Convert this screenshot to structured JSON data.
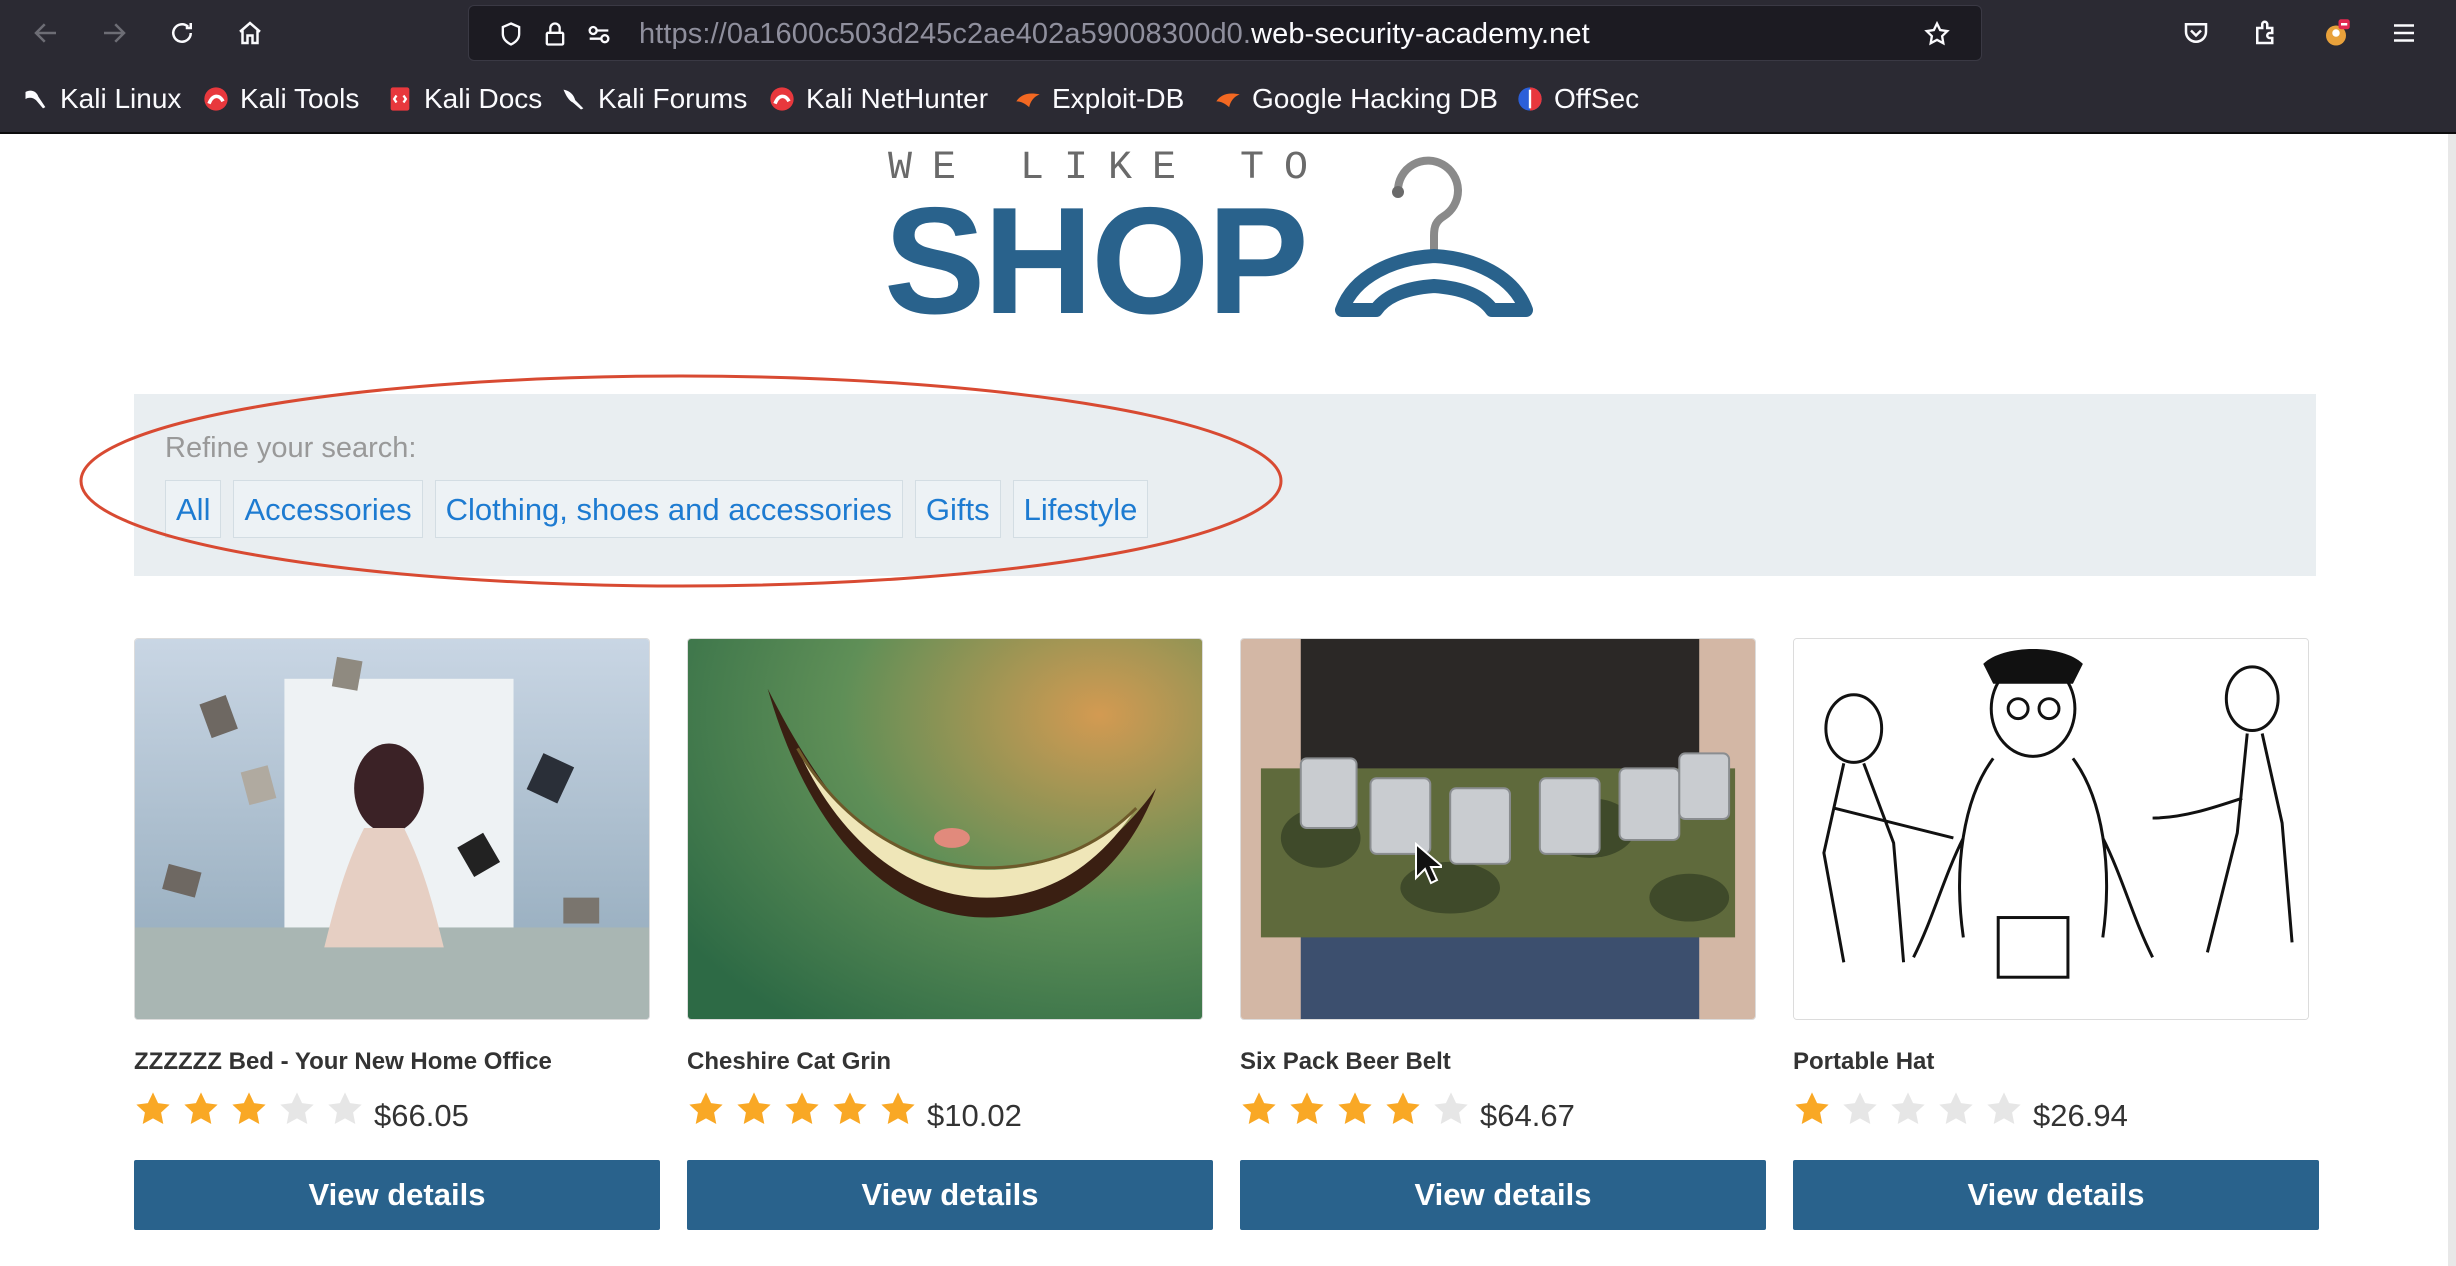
{
  "browser": {
    "url_prefix": "https://0a1600c503d245c2ae402a59008300d0.",
    "url_domain": "web-security-academy.net",
    "icons": [
      "back-icon",
      "forward-icon",
      "reload-icon",
      "home-icon",
      "shield-icon",
      "lock-icon",
      "permissions-icon",
      "bookmark-star-icon",
      "pocket-icon",
      "extensions-icon",
      "account-icon",
      "menu-icon"
    ]
  },
  "bookmarks": [
    {
      "label": "Kali Linux",
      "icon": "kali-dragon-icon"
    },
    {
      "label": "Kali Tools",
      "icon": "kali-tools-icon"
    },
    {
      "label": "Kali Docs",
      "icon": "kali-docs-icon"
    },
    {
      "label": "Kali Forums",
      "icon": "kali-forums-icon"
    },
    {
      "label": "Kali NetHunter",
      "icon": "kali-nethunter-icon"
    },
    {
      "label": "Exploit-DB",
      "icon": "exploit-db-icon"
    },
    {
      "label": "Google Hacking DB",
      "icon": "ghdb-icon"
    },
    {
      "label": "OffSec",
      "icon": "offsec-icon"
    }
  ],
  "logo": {
    "tagline": "WE LIKE TO",
    "main": "SHOP"
  },
  "search": {
    "label": "Refine your search:",
    "filters": [
      "All",
      "Accessories",
      "Clothing, shoes and accessories",
      "Gifts",
      "Lifestyle"
    ]
  },
  "products": [
    {
      "title": "ZZZZZZ Bed - Your New Home Office",
      "rating": 3,
      "price": "$66.05",
      "button": "View details"
    },
    {
      "title": "Cheshire Cat Grin",
      "rating": 5,
      "price": "$10.02",
      "button": "View details"
    },
    {
      "title": "Six Pack Beer Belt",
      "rating": 4,
      "price": "$64.67",
      "button": "View details"
    },
    {
      "title": "Portable Hat",
      "rating": 1,
      "price": "$26.94",
      "button": "View details"
    }
  ],
  "colors": {
    "brand": "#29628c",
    "link": "#1d7bd1",
    "star_on": "#f9a825",
    "star_off": "#e6e6e6",
    "annotation": "#d84a32"
  }
}
